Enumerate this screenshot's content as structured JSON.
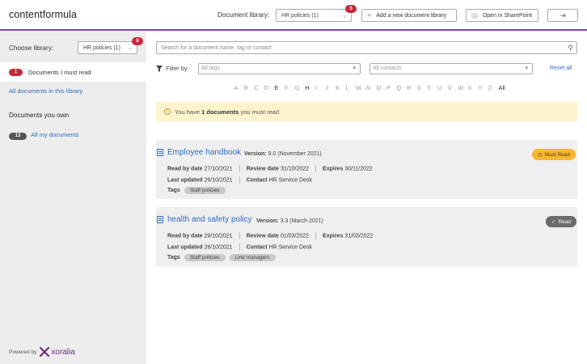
{
  "header": {
    "logo_part1": "content",
    "logo_part2": "formula",
    "library_label": "Document library:",
    "library_value": "HR policies (1)",
    "library_badge": "5",
    "add_library_label": "Add a new document library",
    "sharepoint_label": "Open in SharePoint"
  },
  "sidebar": {
    "choose_label": "Choose library:",
    "library_value": "HR policies (1)",
    "library_badge": "8",
    "must_read_count": "1",
    "must_read_label": "Documents I must read",
    "all_docs_label": "All documents in this library",
    "own_heading": "Documents you own",
    "own_count": "13",
    "own_label": "All my documents",
    "powered_label": "Powered by",
    "brand": "xoralia"
  },
  "main": {
    "search_placeholder": "Search for a document name, tag or contact",
    "filter_label": "Filter by:",
    "tags_placeholder": "All tags",
    "contacts_placeholder": "All contacts",
    "reset_label": "Reset all",
    "alphabet": [
      "A",
      "B",
      "C",
      "D",
      "E",
      "F",
      "G",
      "H",
      "I",
      "J",
      "K",
      "L",
      "M",
      "N",
      "O",
      "P",
      "Q",
      "R",
      "S",
      "T",
      "U",
      "V",
      "W",
      "X",
      "Y",
      "Z",
      "All"
    ],
    "notice_pre": "You have",
    "notice_count": "1 documents",
    "notice_post": "you must read"
  },
  "documents": [
    {
      "title": "Employee handbook",
      "version_label": "Version:",
      "version": "9.0 (November 2021)",
      "read_by_label": "Read by date",
      "read_by": "27/10/2021",
      "review_label": "Review date",
      "review": "31/10/2022",
      "expires_label": "Expires",
      "expires": "30/11/2022",
      "updated_label": "Last updated",
      "updated": "26/10/2021",
      "contact_label": "Contact",
      "contact": "HR Service Desk",
      "tags_label": "Tags",
      "tags": [
        "Staff policies"
      ],
      "status": "Must Read",
      "status_color": "#f7b731"
    },
    {
      "title": "health and safety policy",
      "version_label": "Version:",
      "version": "3.3 (March 2021)",
      "read_by_label": "Read by date",
      "read_by": "29/10/2021",
      "review_label": "Review date",
      "review": "01/03/2022",
      "expires_label": "Expires",
      "expires": "31/03/2022",
      "updated_label": "Last updated",
      "updated": "26/10/2021",
      "contact_label": "Contact",
      "contact": "HR Service Desk",
      "tags_label": "Tags",
      "tags": [
        "Staff policies",
        "Line managers"
      ],
      "status": "Read",
      "status_color": "#6b6b6b"
    }
  ],
  "colors": {
    "accent": "#8b3fbd",
    "link": "#2d6cc0",
    "badge": "#c8283c"
  }
}
